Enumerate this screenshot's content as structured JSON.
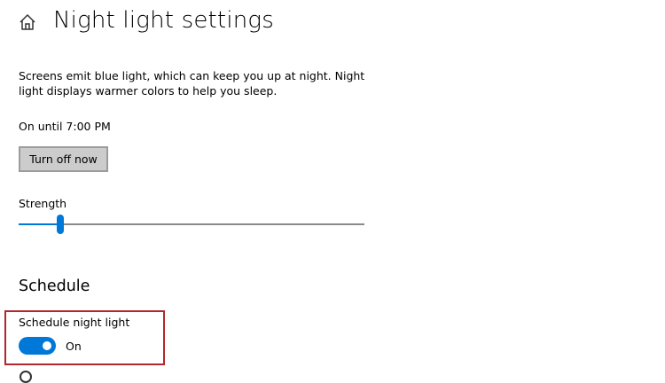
{
  "header": {
    "home_icon": "home-icon",
    "title": "Night light settings"
  },
  "intro": {
    "description": "Screens emit blue light, which can keep you up at night. Night light displays warmer colors to help you sleep."
  },
  "status": {
    "text": "On until 7:00 PM",
    "button_label": "Turn off now"
  },
  "strength": {
    "label": "Strength",
    "value_fraction": 0.12
  },
  "schedule": {
    "heading": "Schedule",
    "toggle_label": "Schedule night light",
    "toggle_on": true,
    "toggle_state_text": "On"
  },
  "colors": {
    "accent": "#0078d7",
    "highlight_border": "#b2272d",
    "button_bg": "#cccccc"
  }
}
